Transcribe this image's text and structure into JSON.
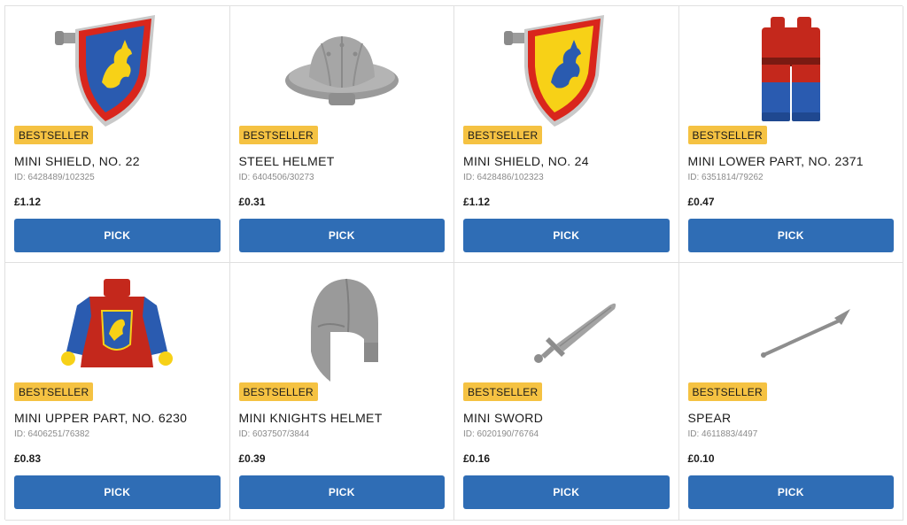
{
  "products": [
    {
      "badge": "BESTSELLER",
      "name": "MINI SHIELD, NO. 22",
      "id": "ID: 6428489/102325",
      "price": "£1.12",
      "button": "PICK",
      "image": "shield-blue-icon"
    },
    {
      "badge": "BESTSELLER",
      "name": "STEEL HELMET",
      "id": "ID: 6404506/30273",
      "price": "£0.31",
      "button": "PICK",
      "image": "steel-helmet-icon"
    },
    {
      "badge": "BESTSELLER",
      "name": "MINI SHIELD, NO. 24",
      "id": "ID: 6428486/102323",
      "price": "£1.12",
      "button": "PICK",
      "image": "shield-yellow-icon"
    },
    {
      "badge": "BESTSELLER",
      "name": "MINI LOWER PART, NO. 2371",
      "id": "ID: 6351814/79262",
      "price": "£0.47",
      "button": "PICK",
      "image": "legs-icon"
    },
    {
      "badge": "BESTSELLER",
      "name": "MINI UPPER PART, NO. 6230",
      "id": "ID: 6406251/76382",
      "price": "£0.83",
      "button": "PICK",
      "image": "torso-icon"
    },
    {
      "badge": "BESTSELLER",
      "name": "MINI KNIGHTS HELMET",
      "id": "ID: 6037507/3844",
      "price": "£0.39",
      "button": "PICK",
      "image": "knights-helmet-icon"
    },
    {
      "badge": "BESTSELLER",
      "name": "MINI SWORD",
      "id": "ID: 6020190/76764",
      "price": "£0.16",
      "button": "PICK",
      "image": "sword-icon"
    },
    {
      "badge": "BESTSELLER",
      "name": "SPEAR",
      "id": "ID: 4611883/4497",
      "price": "£0.10",
      "button": "PICK",
      "image": "spear-icon"
    }
  ],
  "colors": {
    "badge": "#f5c242",
    "button": "#2f6db5",
    "border": "#e0e0e0",
    "lego_red": "#c4281c",
    "lego_blue": "#2a5bb0",
    "lego_yellow": "#f7d117",
    "lego_grey": "#a0a0a0"
  }
}
